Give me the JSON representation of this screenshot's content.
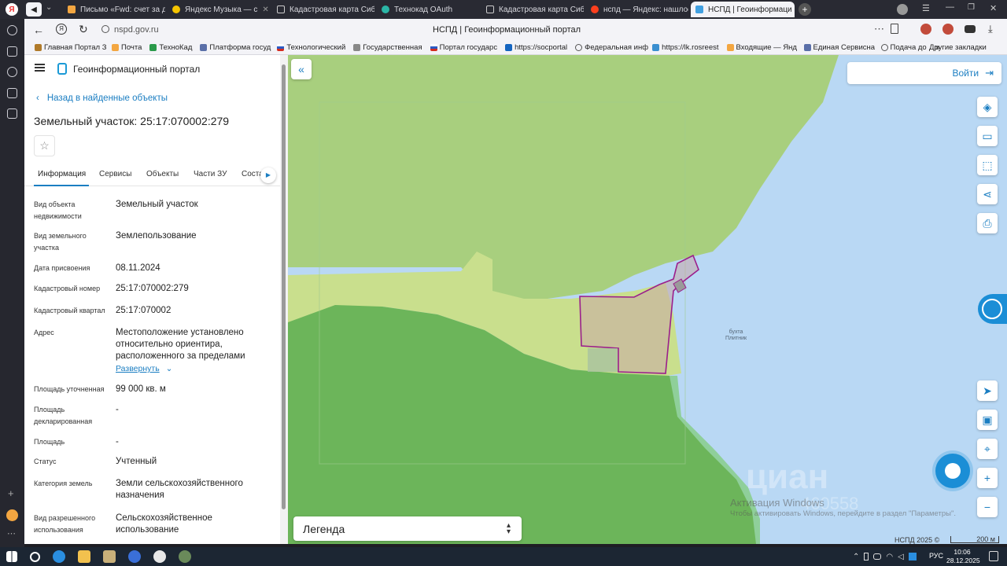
{
  "browser": {
    "tabs": [
      {
        "label": "Письмо «Fwd: счет за де",
        "color": "#f3a641"
      },
      {
        "label": "Яндекс Музыка — с",
        "color": "#f5c400"
      },
      {
        "label": "Кадастровая карта Сиби",
        "color": "#ffffff"
      },
      {
        "label": "Технокад OAuth",
        "color": "#2bb5a6"
      },
      {
        "label": "Кадастровая карта Сиби",
        "color": "#ffffff"
      },
      {
        "label": "нспд — Яндекс: нашлось",
        "color": "#fc3f1d"
      },
      {
        "label": "НСПД | Геоинформаци",
        "color": "#41a0e0"
      }
    ],
    "url": "nspd.gov.ru",
    "page_title": "НСПД | Геоинформационный портал",
    "bookmarks": [
      "Главная Портал З",
      "Почта",
      "ТехноКад",
      "Платформа госуд",
      "Технологический",
      "Государственная",
      "Портал государс",
      "https://socportal",
      "Федеральная инф",
      "https://lk.rosreest",
      "Входящие — Янд",
      "Единая Сервисна",
      "Подача до"
    ],
    "more": "»",
    "other_bookmarks": "Другие закладки"
  },
  "panel": {
    "portal_title": "Геоинформационный портал",
    "back_link": "Назад в найденные объекты",
    "object_title": "Земельный участок: 25:17:070002:279",
    "tabs": [
      "Информация",
      "Сервисы",
      "Объекты",
      "Части ЗУ",
      "Соста"
    ],
    "fields": [
      {
        "key": "Вид объекта недвижимости",
        "value": "Земельный участок"
      },
      {
        "key": "Вид земельного участка",
        "value": "Землепользование"
      },
      {
        "key": "Дата присвоения",
        "value": "08.11.2024"
      },
      {
        "key": "Кадастровый номер",
        "value": "25:17:070002:279"
      },
      {
        "key": "Кадастровый квартал",
        "value": "25:17:070002"
      },
      {
        "key": "Адрес",
        "value": "Местоположение установлено относительно ориентира, расположенного за пределами"
      },
      {
        "key": "Площадь уточненная",
        "value": "99 000 кв. м"
      },
      {
        "key": "Площадь декларированная",
        "value": "-"
      },
      {
        "key": "Площадь",
        "value": "-"
      },
      {
        "key": "Статус",
        "value": "Учтенный"
      },
      {
        "key": "Категория земель",
        "value": "Земли сельскохозяйственного назначения"
      },
      {
        "key": "Вид разрешенного использования",
        "value": "Сельскохозяйственное использование"
      }
    ],
    "expand": "Развернуть"
  },
  "map": {
    "login": "Войти",
    "bay_label_1": "бухта",
    "bay_label_2": "Плитник",
    "legend": "Легенда",
    "copyright": "НСПД 2025 ©",
    "scale": "200 м",
    "watermark": "циан",
    "watermark_id": "460558",
    "activation_1": "Активация Windows",
    "activation_2": "Чтобы активировать Windows, перейдите в раздел \"Параметры\"."
  },
  "taskbar": {
    "lang": "РУС",
    "time": "10:06",
    "date": "28.12.2025"
  },
  "colors": {
    "accent": "#1b7ec2",
    "parcel": "#9b1e8c",
    "water": "#b9d8f4",
    "forest": "#6cb55a",
    "meadow": "#a8cf7e",
    "field": "#c9df8d"
  }
}
